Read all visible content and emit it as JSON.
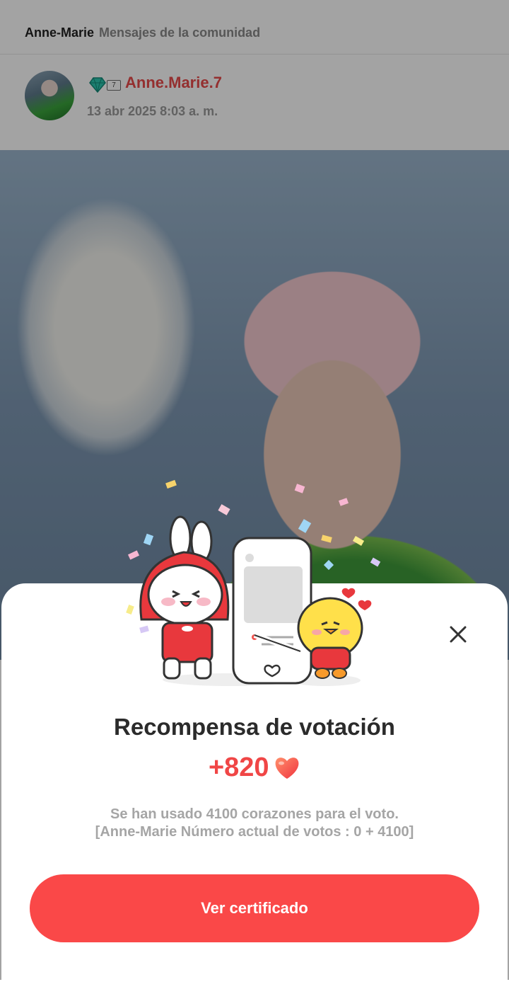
{
  "header": {
    "community": "Anne-Marie",
    "section": "Mensajes de la comunidad"
  },
  "post": {
    "username": "Anne.Marie.7",
    "badge_level": "7",
    "date": "13 abr 2025 8:03 a. m.",
    "badge_icon": "diamond-heart-icon"
  },
  "modal": {
    "title": "Recompensa de votación",
    "amount": "+820",
    "amount_icon": "heart-icon",
    "info_line1": "Se han usado 4100 corazones para el voto.",
    "info_line2": "[Anne-Marie Número actual de votos : 0 + 4100]",
    "button_label": "Ver certificado",
    "close_icon": "close-icon"
  },
  "colors": {
    "accent": "#fa4848",
    "username": "#e84a4a",
    "heart": "#f25a4f",
    "badge": "#1fae9a"
  }
}
